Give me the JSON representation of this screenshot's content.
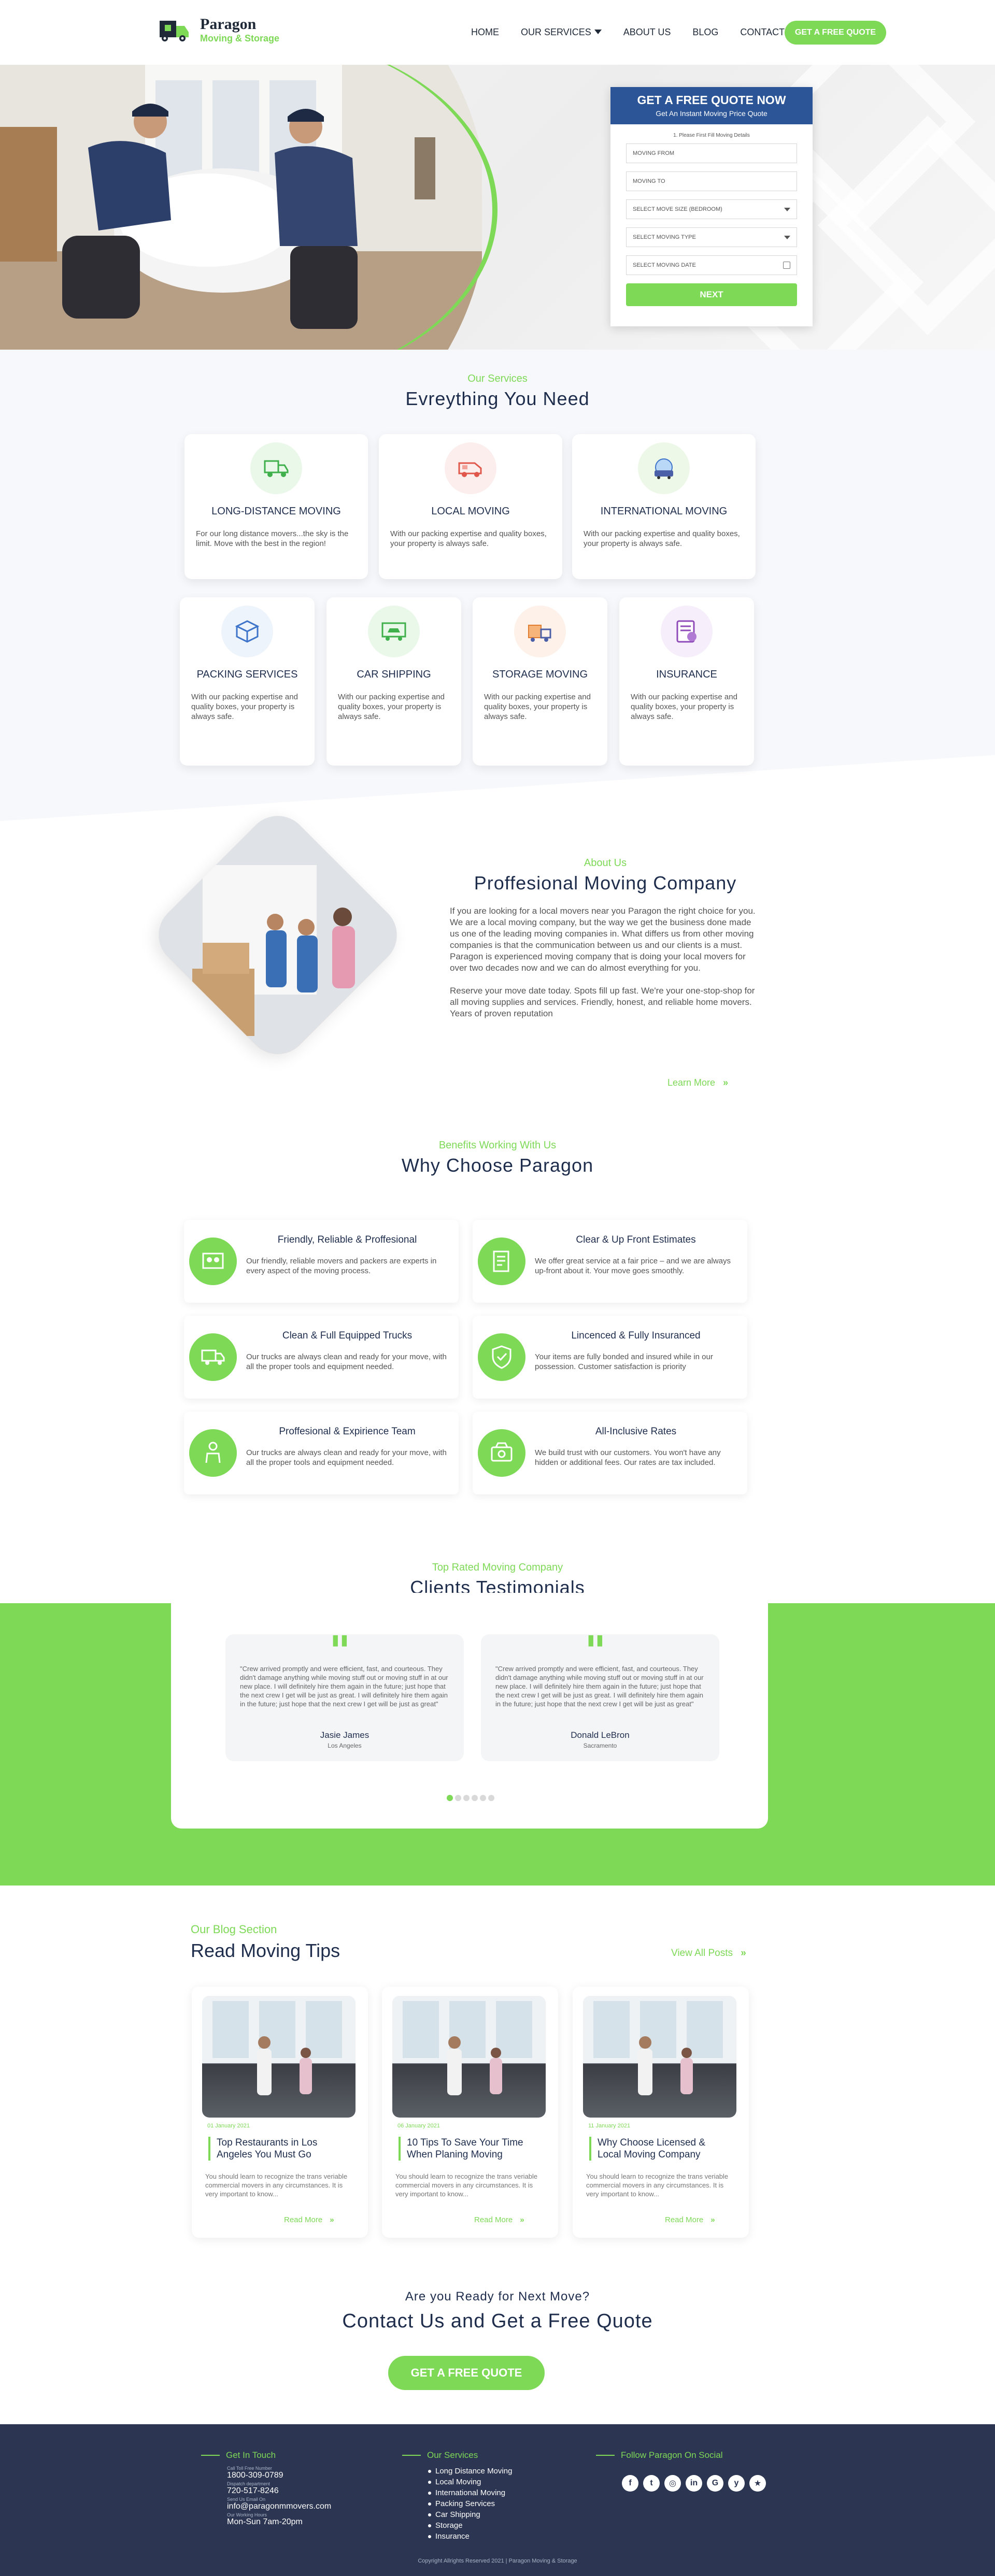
{
  "header": {
    "brand_name": "Paragon",
    "brand_sub": "Moving & Storage",
    "nav": [
      "HOME",
      "OUR SERVICES",
      "ABOUT US",
      "BLOG",
      "CONTACT US"
    ],
    "cta": "GET A FREE QUOTE"
  },
  "quote_form": {
    "title": "GET A FREE QUOTE NOW",
    "subtitle": "Get An Instant Moving Price Quote",
    "note": "1. Please First Fill Moving Details",
    "fields": [
      "MOVING FROM",
      "MOVING TO",
      "SELECT MOVE SIZE (BEDROOM)",
      "SELECT MOVING TYPE",
      "SELECT MOVING DATE"
    ],
    "next": "NEXT"
  },
  "services": {
    "eyebrow": "Our Services",
    "title": "Evreything You Need",
    "items": [
      {
        "title": "LONG-DISTANCE MOVING",
        "text": "For our long distance movers...the sky is the limit. Move with the best in the region!",
        "icon": "truck-icon",
        "tint": "#eaf8ea"
      },
      {
        "title": "LOCAL MOVING",
        "text": "With our packing expertise and quality boxes, your property is always safe.",
        "icon": "van-icon",
        "tint": "#fdeeee"
      },
      {
        "title": "INTERNATIONAL MOVING",
        "text": "With our packing expertise and quality boxes, your property is always safe.",
        "icon": "globe-truck-icon",
        "tint": "#eef8e8"
      },
      {
        "title": "PACKING SERVICES",
        "text": "With our packing expertise and quality boxes, your property is always safe.",
        "icon": "box-icon",
        "tint": "#eef4fb"
      },
      {
        "title": "CAR SHIPPING",
        "text": "With our packing expertise and quality boxes, your property is always safe.",
        "icon": "car-icon",
        "tint": "#eaf8ea"
      },
      {
        "title": "STORAGE MOVING",
        "text": "With our packing expertise and quality boxes, your property is always safe.",
        "icon": "storage-icon",
        "tint": "#fdf1e9"
      },
      {
        "title": "INSURANCE",
        "text": "With our packing expertise and quality boxes, your property is always safe.",
        "icon": "insurance-icon",
        "tint": "#f6eefb"
      }
    ]
  },
  "about": {
    "eyebrow": "About Us",
    "title": "Proffesional Moving Company",
    "p1": "If you are looking for a local movers near you Paragon  the right choice for you. We are a local moving company, but the way we get the business done made us one of the leading moving companies in. What differs us from other moving companies is that the communication between us and our clients is a must. Paragon is experienced moving company that is doing your local movers for over two decades now and we can do almost everything for you.",
    "p2": "Reserve your move date today. Spots fill up fast.  We're your one-stop-shop for all moving supplies and services. Friendly, honest, and reliable home movers.  Years of proven reputation",
    "learn_more": "Learn More"
  },
  "why": {
    "eyebrow": "Benefits Working With Us",
    "title": "Why Choose Paragon",
    "items": [
      {
        "title": "Friendly, Reliable & Proffesional",
        "text": "Our friendly, reliable movers and packers are experts in every aspect of the moving process."
      },
      {
        "title": "Clear & Up Front Estimates",
        "text": "We offer great service at a fair price – and we are always up-front about it. Your move goes smoothly."
      },
      {
        "title": "Clean & Full Equipped Trucks",
        "text": "Our trucks are always clean and ready for your move, with all the proper tools and equipment needed."
      },
      {
        "title": "Lincenced & Fully Insuranced",
        "text": "Your items are fully bonded and insured while in our possession. Customer satisfaction is priority"
      },
      {
        "title": "Proffesional & Expirience Team",
        "text": "Our trucks are always clean and ready for your move, with all the proper tools and equipment needed."
      },
      {
        "title": "All-Inclusive Rates",
        "text": "We build trust with our customers. You won't have any hidden or additional fees. Our rates are tax included."
      }
    ]
  },
  "testimonials": {
    "eyebrow": "Top Rated Moving Company",
    "title": "Clients Testimonials",
    "items": [
      {
        "text": "\"Crew arrived promptly and were efficient, fast, and courteous. They didn't damage anything while moving stuff out or moving stuff in at our new place. I will definitely hire them again in the future; just hope that the next crew I get will be just as great. I will definitely hire them again in the future; just hope that the next crew I get will be just as great\"",
        "name": "Jasie James",
        "city": "Los Angeles"
      },
      {
        "text": "\"Crew arrived promptly and were efficient, fast, and courteous. They didn't damage anything while moving stuff out or moving stuff in at our new place. I will definitely hire them again in the future; just hope that the next crew I get will be just as great. I will definitely hire them again in the future; just hope that the next crew I get will be just as great\"",
        "name": "Donald LeBron",
        "city": "Sacramento"
      }
    ]
  },
  "blog": {
    "eyebrow": "Our Blog Section",
    "title": "Read Moving Tips",
    "view_all": "View All Posts",
    "read_more": "Read More",
    "posts": [
      {
        "date": "01 January 2021",
        "title": "Top Restaurants in Los Angeles You Must Go",
        "text": "You should learn to recognize the trans veriable commercial movers in any circumstances. It is very important to know..."
      },
      {
        "date": "06 January 2021",
        "title": "10 Tips To Save Your Time When Planing Moving",
        "text": "You should learn to recognize the trans veriable commercial movers in any circumstances. It is very important to know..."
      },
      {
        "date": "11 January 2021",
        "title": "Why Choose Licensed & Local Moving Company",
        "text": "You should learn to recognize the trans veriable commercial movers in any circumstances. It is very important to know..."
      }
    ]
  },
  "cta": {
    "sub": "Are you Ready for Next Move?",
    "title": "Contact Us and Get a Free Quote",
    "button": "GET A FREE QUOTE"
  },
  "footer": {
    "contact_head": "Get In Touch",
    "contact": [
      {
        "label": "Call Toll Free Number",
        "value": "1800-309-0789"
      },
      {
        "label": "Dispatch department",
        "value": "720-517-8246"
      },
      {
        "label": "Send Us Email On",
        "value": "info@paragonmmovers.com"
      },
      {
        "label": "Our Working Hours",
        "value": "Mon-Sun 7am-20pm"
      }
    ],
    "services_head": "Our Services",
    "services": [
      "Long Distance Moving",
      "Local Moving",
      "International Moving",
      "Packing Services",
      "Car Shipping",
      "Storage",
      "Insurance"
    ],
    "social_head": "Follow Paragon On Social",
    "socials": [
      {
        "icon": "facebook-icon",
        "glyph": "f"
      },
      {
        "icon": "twitter-icon",
        "glyph": "t"
      },
      {
        "icon": "instagram-icon",
        "glyph": "◎"
      },
      {
        "icon": "linkedin-icon",
        "glyph": "in"
      },
      {
        "icon": "google-icon",
        "glyph": "G"
      },
      {
        "icon": "yelp-icon",
        "glyph": "y"
      },
      {
        "icon": "star-icon",
        "glyph": "★"
      }
    ],
    "copyright": "Copyright Allrights Reserved 2021 | Paragon Moving & Storage"
  },
  "colors": {
    "accent": "#7ed957",
    "navy": "#2b5596",
    "footer": "#2c3652",
    "heading": "#1f2d4d"
  }
}
